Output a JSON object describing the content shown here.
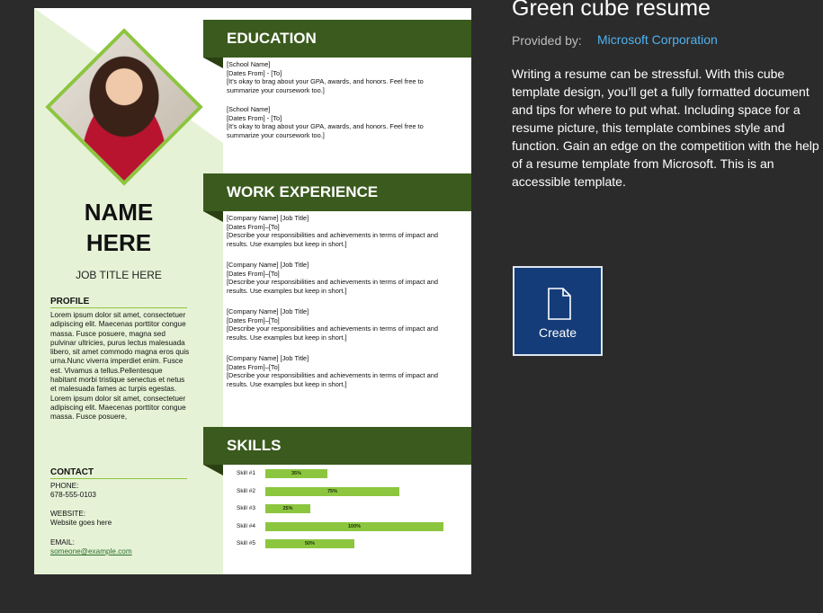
{
  "window": {
    "title": "Green cube resume",
    "provided_by_label": "Provided by:",
    "provider": "Microsoft Corporation",
    "description": "Writing a resume can be stressful. With this cube template design, you’ll get a fully formatted document and tips for where to put what. Including space for a resume picture, this template combines style and function. Gain an edge on the competition with the help of a resume template from Microsoft. This is an accessible template.",
    "create_label": "Create",
    "create_icon": "document-icon"
  },
  "resume": {
    "name_line1": "NAME",
    "name_line2": "HERE",
    "job_title": "JOB TITLE HERE",
    "profile_heading": "PROFILE",
    "profile_text": "Lorem ipsum dolor sit amet, consectetuer adipiscing elit. Maecenas porttitor congue massa. Fusce posuere, magna sed pulvinar ultricies, purus lectus malesuada libero, sit amet commodo magna eros quis urna.Nunc viverra imperdiet enim. Fusce est. Vivamus a tellus.Pellentesque habitant morbi tristique senectus et netus et malesuada fames ac turpis egestas. Lorem ipsum dolor sit amet, consectetuer adipiscing elit. Maecenas porttitor congue massa. Fusce posuere,",
    "contact_heading": "CONTACT",
    "phone_label": "PHONE:",
    "phone": "678-555-0103",
    "website_label": "WEBSITE:",
    "website": "Website goes here",
    "email_label": "EMAIL:",
    "email": "someone@example.com",
    "education_heading": "EDUCATION",
    "education": [
      {
        "school": "[School Name]",
        "dates": "[Dates From] - [To]",
        "desc": "[It’s okay to brag about your GPA, awards, and honors. Feel free to summarize your coursework too.]"
      },
      {
        "school": "[School Name]",
        "dates": "[Dates From] - [To]",
        "desc": "[It’s okay to brag about your GPA, awards, and honors. Feel free to summarize your coursework too.]"
      }
    ],
    "work_heading": "WORK EXPERIENCE",
    "work": [
      {
        "company": "[Company Name]  [Job Title]",
        "dates": "[Dates From]–[To]",
        "desc": "[Describe your responsibilities and achievements in terms of impact and results. Use examples but keep in short.]"
      },
      {
        "company": "[Company Name]  [Job Title]",
        "dates": "[Dates From]–[To]",
        "desc": "[Describe your responsibilities and achievements in terms of impact and results. Use examples but keep in short.]"
      },
      {
        "company": "[Company Name]  [Job Title]",
        "dates": "[Dates From]–[To]",
        "desc": "[Describe your responsibilities and achievements in terms of impact and results. Use examples but keep in short.]"
      },
      {
        "company": "[Company Name]  [Job Title]",
        "dates": "[Dates From]–[To]",
        "desc": "[Describe your responsibilities and achievements in terms of impact and results. Use examples but keep in short.]"
      }
    ],
    "skills_heading": "SKILLS",
    "skills": [
      {
        "label": "Skill #1",
        "value_text": "35%",
        "value": 0.35
      },
      {
        "label": "Skill #2",
        "value_text": "75%",
        "value": 0.75
      },
      {
        "label": "Skill #3",
        "value_text": "25%",
        "value": 0.25
      },
      {
        "label": "Skill #4",
        "value_text": "100%",
        "value": 1.0
      },
      {
        "label": "Skill #5",
        "value_text": "50%",
        "value": 0.5
      }
    ]
  },
  "colors": {
    "accent_green": "#8cc63f",
    "dark_green": "#3b5a1e",
    "create_blue": "#143c78",
    "link_blue": "#4fb3f0"
  }
}
